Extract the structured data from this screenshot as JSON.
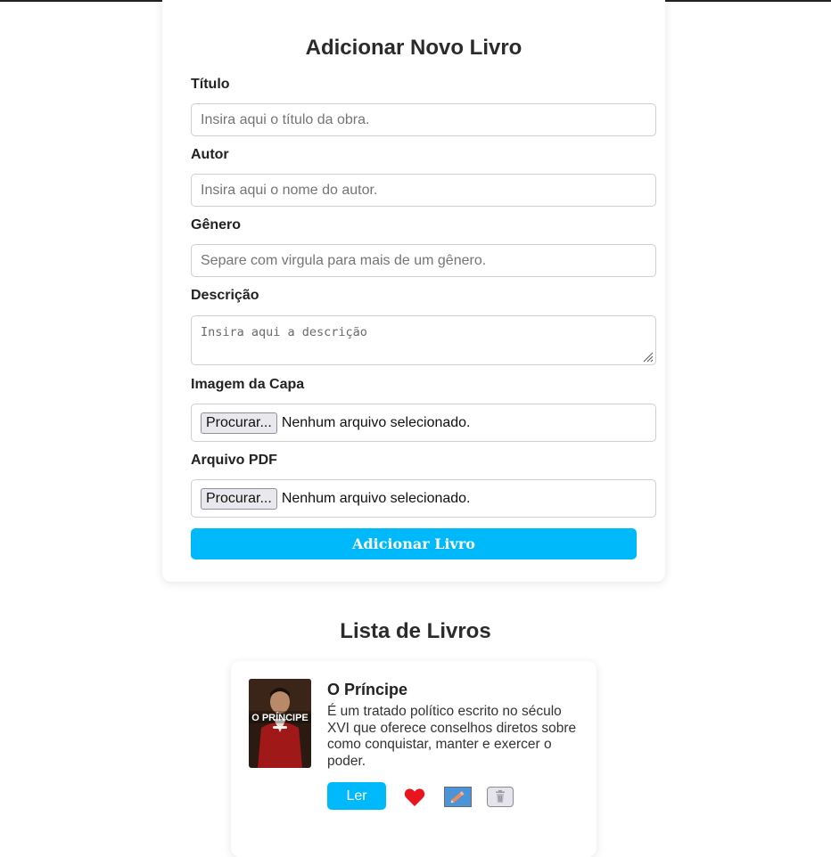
{
  "form": {
    "title": "Adicionar Novo Livro",
    "title_label": "Título",
    "title_placeholder": "Insira aqui o título da obra.",
    "author_label": "Autor",
    "author_placeholder": "Insira aqui o nome do autor.",
    "genre_label": "Gênero",
    "genre_placeholder": "Separe com virgula para mais de um gênero.",
    "description_label": "Descrição",
    "description_placeholder": "Insira aqui a descrição",
    "cover_label": "Imagem da Capa",
    "cover_button": "Procurar...",
    "cover_status": "Nenhum arquivo selecionado.",
    "pdf_label": "Arquivo PDF",
    "pdf_button": "Procurar...",
    "pdf_status": "Nenhum arquivo selecionado.",
    "submit_label": "Adicionar Livro"
  },
  "list": {
    "title": "Lista de Livros",
    "books": [
      {
        "title": "O Príncipe",
        "cover_text": "O PRÍNCIPE",
        "description": "É um tratado político escrito no século XVI que oferece conselhos diretos sobre como conquistar, manter e exercer o poder.",
        "read_label": "Ler"
      }
    ]
  },
  "colors": {
    "accent": "#00b9fb",
    "favorite": "#e8141e",
    "edit": "#4c94d8"
  },
  "icons": [
    "heart-icon",
    "edit-pencil-icon",
    "trash-icon"
  ]
}
